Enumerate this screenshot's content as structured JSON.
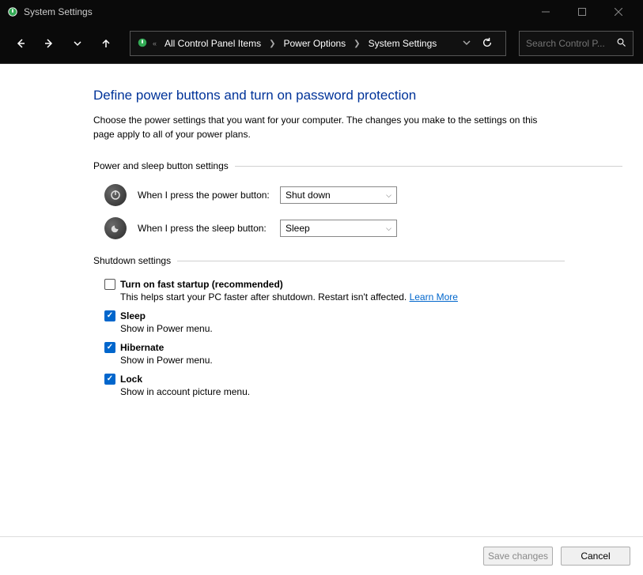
{
  "window": {
    "title": "System Settings"
  },
  "breadcrumb": {
    "items": [
      "All Control Panel Items",
      "Power Options",
      "System Settings"
    ]
  },
  "search": {
    "placeholder": "Search Control P..."
  },
  "page": {
    "title": "Define power buttons and turn on password protection",
    "description": "Choose the power settings that you want for your computer. The changes you make to the settings on this page apply to all of your power plans."
  },
  "sections": {
    "powerSleep": {
      "title": "Power and sleep button settings",
      "powerButton": {
        "label": "When I press the power button:",
        "value": "Shut down"
      },
      "sleepButton": {
        "label": "When I press the sleep button:",
        "value": "Sleep"
      }
    },
    "shutdown": {
      "title": "Shutdown settings",
      "items": [
        {
          "label": "Turn on fast startup (recommended)",
          "desc": "This helps start your PC faster after shutdown. Restart isn't affected. ",
          "link": "Learn More",
          "checked": false
        },
        {
          "label": "Sleep",
          "desc": "Show in Power menu.",
          "checked": true
        },
        {
          "label": "Hibernate",
          "desc": "Show in Power menu.",
          "checked": true
        },
        {
          "label": "Lock",
          "desc": "Show in account picture menu.",
          "checked": true
        }
      ]
    }
  },
  "footer": {
    "save": "Save changes",
    "cancel": "Cancel"
  }
}
